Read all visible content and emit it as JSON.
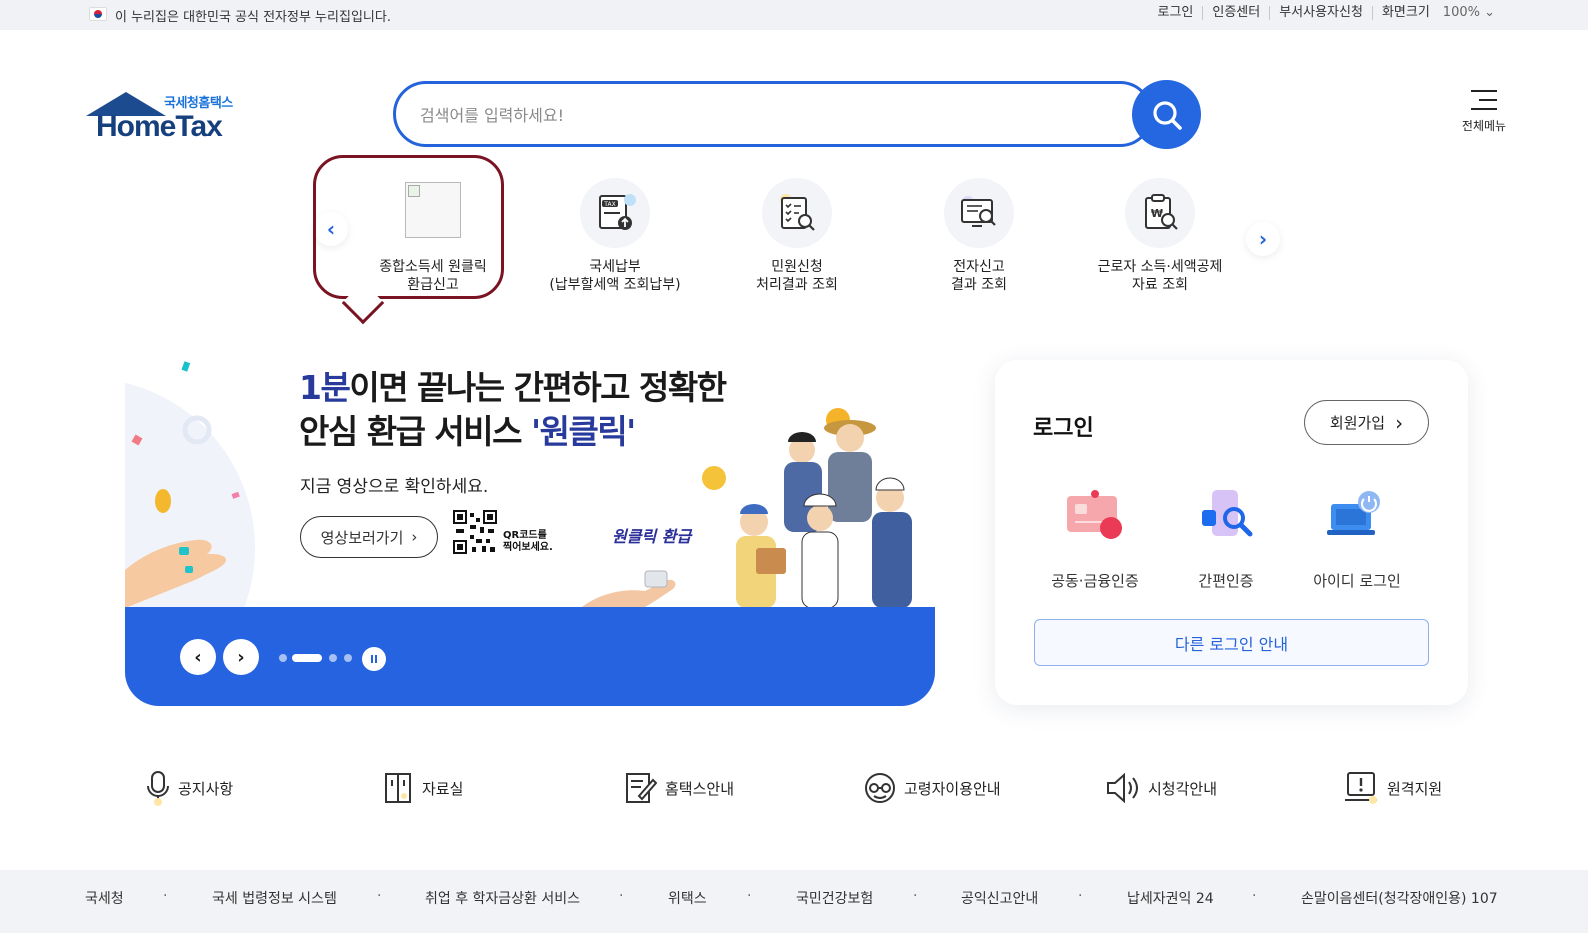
{
  "gov_bar": {
    "notice": "이 누리집은 대한민국 공식 전자정부 누리집입니다.",
    "links": [
      "로그인",
      "인증센터",
      "부서사용자신청",
      "화면크기"
    ],
    "zoom": "100%"
  },
  "logo": {
    "sub": "국세청홈택스",
    "main": "HomeTax"
  },
  "search": {
    "placeholder": "검색어를 입력하세요!"
  },
  "all_menu": {
    "label": "전체메뉴"
  },
  "quick_menu": [
    {
      "line1": "종합소득세 원클릭",
      "line2": "환급신고"
    },
    {
      "line1": "국세납부",
      "line2": "(납부할세액 조회납부)"
    },
    {
      "line1": "민원신청",
      "line2": "처리결과 조회"
    },
    {
      "line1": "전자신고",
      "line2": "결과 조회"
    },
    {
      "line1": "근로자 소득·세액공제",
      "line2": "자료 조회"
    }
  ],
  "banner": {
    "title_hl": "1분",
    "title_rest": "이면 끝나는 간편하고 정확한",
    "title_line2_a": "안심 환급 서비스 ",
    "title_line2_hl": "'원클릭'",
    "subtitle": "지금 영상으로 확인하세요.",
    "video_button": "영상보러가기",
    "qr_line1": "QR코드를",
    "qr_line2": "찍어보세요.",
    "tag": "원클릭 환급"
  },
  "login": {
    "title": "로그인",
    "join": "회원가입",
    "options": [
      "공동·금융인증",
      "간편인증",
      "아이디 로그인"
    ],
    "other": "다른 로그인 안내"
  },
  "quick_links": [
    "공지사항",
    "자료실",
    "홈택스안내",
    "고령자이용안내",
    "시청각안내",
    "원격지원"
  ],
  "footer": [
    "국세청",
    "국세 법령정보 시스템",
    "취업 후 학자금상환 서비스",
    "위택스",
    "국민건강보험",
    "공익신고안내",
    "납세자권익 24",
    "손말이음센터(청각장애인용) 107"
  ]
}
